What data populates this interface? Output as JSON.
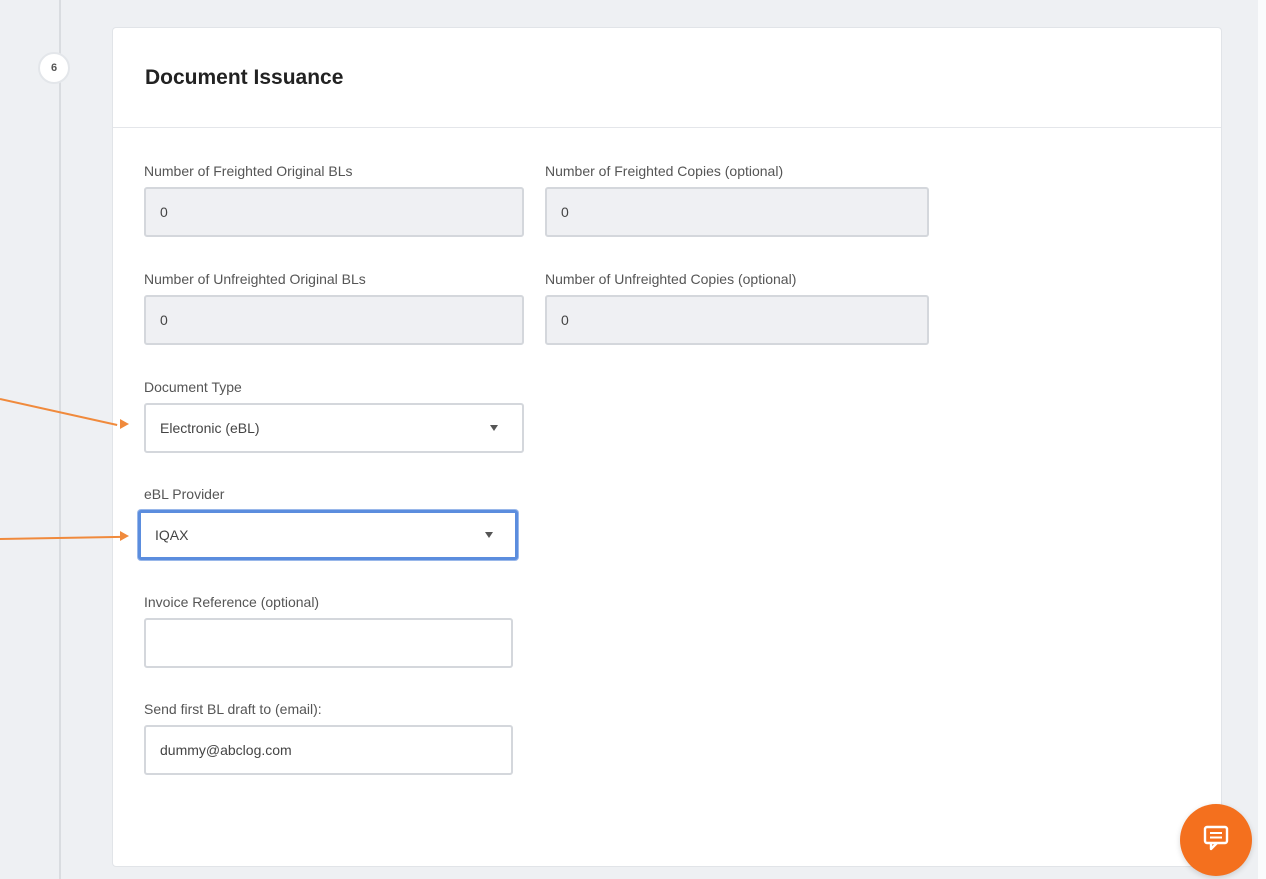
{
  "step": {
    "number": "6"
  },
  "card": {
    "title": "Document Issuance"
  },
  "fields": {
    "freighted_originals": {
      "label": "Number of Freighted Original BLs",
      "value": "0"
    },
    "freighted_copies": {
      "label": "Number of Freighted Copies (optional)",
      "value": "0"
    },
    "unfreighted_originals": {
      "label": "Number of Unfreighted Original BLs",
      "value": "0"
    },
    "unfreighted_copies": {
      "label": "Number of Unfreighted Copies (optional)",
      "value": "0"
    },
    "document_type": {
      "label": "Document Type",
      "value": "Electronic (eBL)"
    },
    "ebl_provider": {
      "label": "eBL Provider",
      "value": "IQAX"
    },
    "invoice_reference": {
      "label": "Invoice Reference (optional)",
      "value": ""
    },
    "draft_email": {
      "label": "Send first BL draft to (email):",
      "value": "dummy@abclog.com"
    }
  },
  "icons": {
    "chat": "chat-icon",
    "dropdown": "chevron-down-icon"
  },
  "colors": {
    "accent": "#f4701e",
    "focus": "#5b8dde",
    "annotation_arrow": "#f08a3c"
  }
}
